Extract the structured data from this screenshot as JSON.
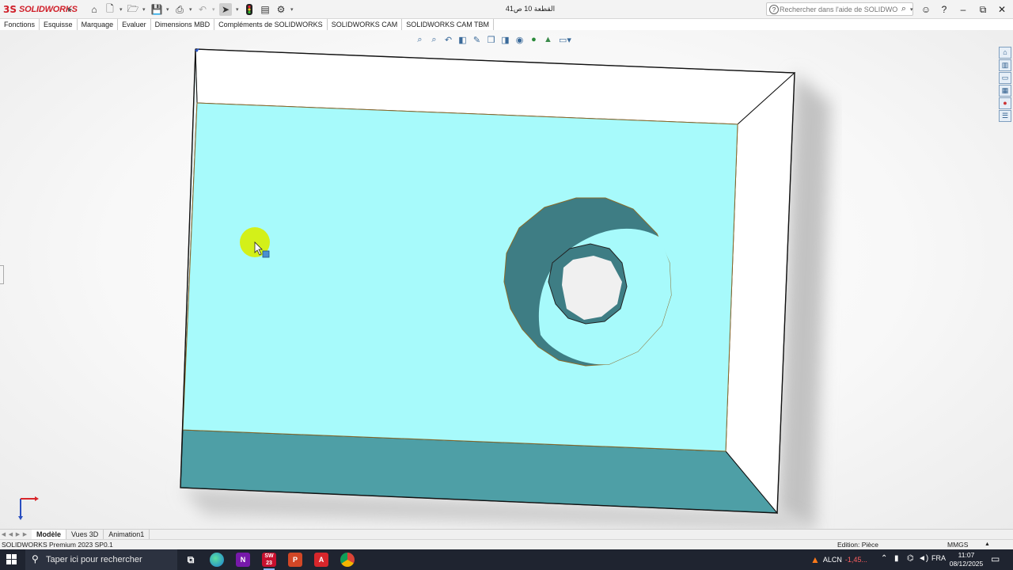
{
  "app": {
    "logo_mark": "3S",
    "logo_text": "SOLIDWORKS"
  },
  "title": {
    "document": "القطعة 10 ص41"
  },
  "titlebar": {
    "icons": [
      "home-icon",
      "new-document-icon",
      "open-folder-icon",
      "save-icon",
      "print-icon",
      "undo-icon",
      "select-arrow-icon",
      "traffic-light-icon",
      "file-properties-icon",
      "options-gear-icon"
    ]
  },
  "search": {
    "placeholder": "Rechercher dans l'aide de SOLIDWORKS"
  },
  "window_buttons": {
    "minimize": "–",
    "restore": "⧉",
    "close": "✕"
  },
  "command_tabs": [
    "Fonctions",
    "Esquisse",
    "Marquage",
    "Evaluer",
    "Dimensions MBD",
    "Compléments de SOLIDWORKS",
    "SOLIDWORKS CAM",
    "SOLIDWORKS CAM TBM"
  ],
  "heads_up_toolbar": [
    "zoom-to-fit-icon",
    "zoom-area-icon",
    "previous-view-icon",
    "section-view-icon",
    "dynamic-annotation-icon",
    "view-orientation-icon",
    "display-style-icon",
    "hide-show-icon",
    "edit-appearance-icon",
    "apply-scene-icon",
    "view-settings-icon"
  ],
  "task_pane": [
    "home-icon",
    "design-library-icon",
    "file-explorer-icon",
    "view-palette-icon",
    "appearances-icon",
    "custom-properties-icon"
  ],
  "model_tabs": [
    {
      "label": "Modèle",
      "active": true
    },
    {
      "label": "Vues 3D",
      "active": false
    },
    {
      "label": "Animation1",
      "active": false
    }
  ],
  "status": {
    "product": "SOLIDWORKS Premium 2023 SP0.1",
    "mode": "Edition: Pièce",
    "units": "MMGS"
  },
  "taskbar": {
    "search_placeholder": "Taper ici pour rechercher",
    "apps": [
      "task-view-icon",
      "edge-icon",
      "onenote-icon",
      "solidworks-icon",
      "powerpoint-icon",
      "acrobat-icon",
      "chrome-icon"
    ],
    "stock": {
      "symbol": "ALCN",
      "change": "-1,45..."
    },
    "language": "FRA",
    "time": "11:07",
    "date": "08/12/2025"
  },
  "colors": {
    "face_top": "#a7fafb",
    "face_dark": "#4e9fa6",
    "face_white": "#ffffff",
    "hole_wall": "#3e7d84",
    "cursor_highlight": "#d8ee00",
    "taskbar": "#1f2430"
  }
}
